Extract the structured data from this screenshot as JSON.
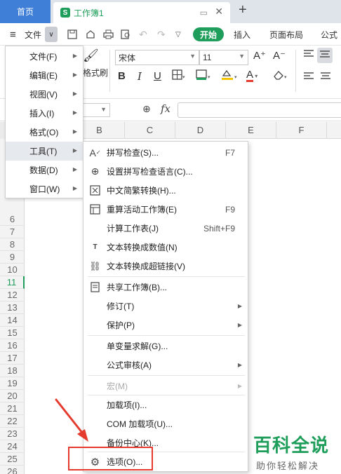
{
  "titlebar": {
    "home_tab": "首页",
    "doc_badge": "S",
    "doc_tab": "工作簿1",
    "monitor_icon": "▭",
    "close_icon": "✕",
    "newtab_icon": "+"
  },
  "menubar": {
    "hamburger": "≡",
    "file": "文件",
    "file_dropdown": "∨",
    "start": "开始",
    "insert": "插入",
    "layout": "页面布局",
    "formula": "公式"
  },
  "ribbon": {
    "font_name": "宋体",
    "font_size": "11",
    "format_brush": "格式刷",
    "grow": "A⁺",
    "shrink": "A⁻",
    "bold": "B",
    "italic": "I",
    "underline": "U",
    "font_color": "A"
  },
  "formulabar": {
    "fx": "fx",
    "zoom_icon": "⊕"
  },
  "columns": [
    "B",
    "C",
    "D",
    "E",
    "F"
  ],
  "rows": [
    "6",
    "7",
    "8",
    "9",
    "10",
    "11",
    "12",
    "13",
    "14",
    "15",
    "16",
    "17",
    "18",
    "19",
    "20",
    "21",
    "22",
    "23",
    "24",
    "25",
    "26"
  ],
  "active_row": "11",
  "file_menu": {
    "items": [
      {
        "label": "文件(F)"
      },
      {
        "label": "编辑(E)"
      },
      {
        "label": "视图(V)"
      },
      {
        "label": "插入(I)"
      },
      {
        "label": "格式(O)"
      },
      {
        "label": "工具(T)"
      },
      {
        "label": "数据(D)"
      },
      {
        "label": "窗口(W)"
      }
    ],
    "highlighted": "工具(T)"
  },
  "tools_menu": {
    "items": [
      {
        "label": "拼写检查(S)...",
        "shortcut": "F7",
        "icon": "spellcheck-icon"
      },
      {
        "label": "设置拼写检查语言(C)...",
        "shortcut": "",
        "icon": "globe-icon"
      },
      {
        "label": "中文简繁转换(H)...",
        "shortcut": "",
        "icon": "convert-icon"
      },
      {
        "label": "重算活动工作簿(E)",
        "shortcut": "F9",
        "icon": "recalc-icon"
      },
      {
        "label": "计算工作表(J)",
        "shortcut": "Shift+F9",
        "icon": ""
      },
      {
        "label": "文本转换成数值(N)",
        "shortcut": "",
        "icon": "text-number-icon"
      },
      {
        "label": "文本转换成超链接(V)",
        "shortcut": "",
        "icon": "link-icon"
      },
      {
        "label": "共享工作簿(B)...",
        "shortcut": "",
        "icon": "share-icon"
      },
      {
        "label": "修订(T)",
        "shortcut": "",
        "icon": ""
      },
      {
        "label": "保护(P)",
        "shortcut": "",
        "icon": ""
      },
      {
        "label": "单变量求解(G)...",
        "shortcut": "",
        "icon": ""
      },
      {
        "label": "公式审核(A)",
        "shortcut": "",
        "icon": ""
      },
      {
        "label": "宏(M)",
        "shortcut": "",
        "icon": ""
      },
      {
        "label": "加载项(I)...",
        "shortcut": "",
        "icon": ""
      },
      {
        "label": "COM 加载项(U)...",
        "shortcut": "",
        "icon": ""
      },
      {
        "label": "备份中心(K)...",
        "shortcut": "",
        "icon": ""
      },
      {
        "label": "选项(O)...",
        "shortcut": "",
        "icon": "gear-icon"
      }
    ]
  },
  "watermark": {
    "title": "百科全说",
    "subtitle": "助你轻松解决"
  },
  "colors": {
    "accent_green": "#1e9e5a",
    "home_tab_blue": "#3f7fd8",
    "annotation_red": "#e53b2f"
  }
}
